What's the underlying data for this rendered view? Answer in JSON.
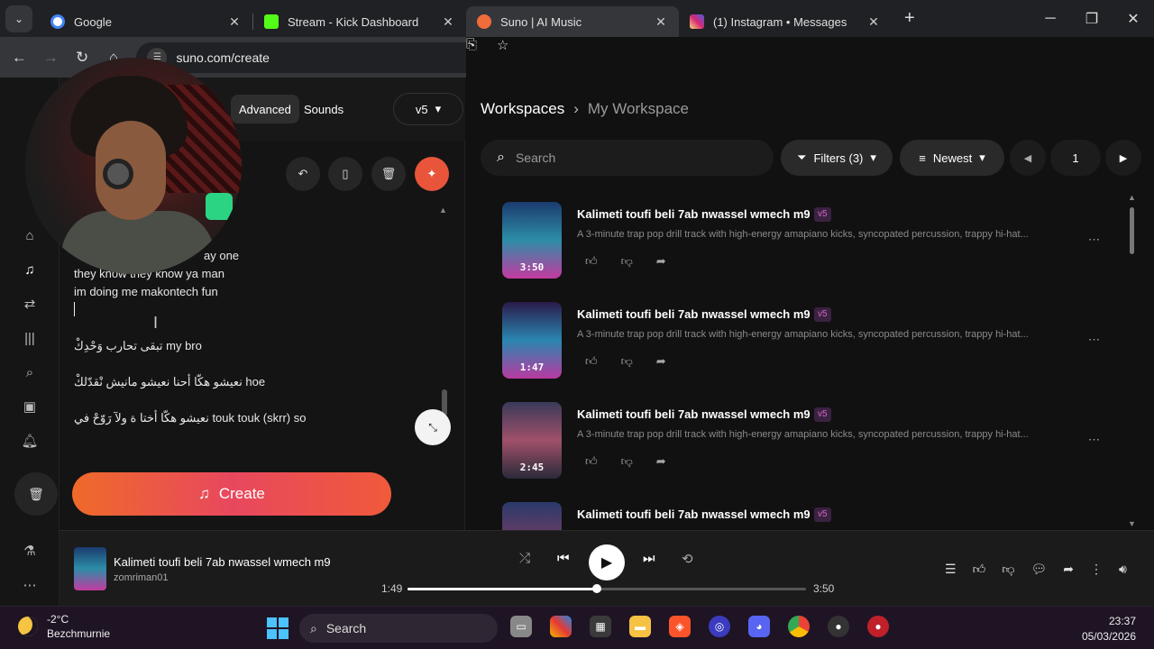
{
  "browser": {
    "tabs": [
      {
        "title": "Google",
        "favicon": "google-favicon",
        "color": "#4285f4"
      },
      {
        "title": "Stream - Kick Dashboard",
        "favicon": "kick-favicon",
        "color": "#53fc18"
      },
      {
        "title": "Suno | AI Music",
        "favicon": "suno-favicon",
        "color": "#f06c3a"
      },
      {
        "title": "(1) Instagram • Messages",
        "favicon": "instagram-favicon",
        "color": "#e1306c"
      }
    ],
    "url": "suno.com/create"
  },
  "create_panel": {
    "modes": [
      "Advanced",
      "Sounds"
    ],
    "version": "v5",
    "lyrics": [
      "they know they know ya man",
      "im doing me makontech fun",
      "",
      "تبقى  تحارب وَحْدِكْ my bro",
      "نعيشو هكّا أحنا  نعيشو مانيش نْقدّلكْ hoe",
      "نعيشو هكّا أختا ة  ولآ رَوّحْ في  touk touk (skrr) so"
    ],
    "partial_line": "ay one",
    "create_label": "Create"
  },
  "workspace": {
    "crumb_root": "Workspaces",
    "crumb_current": "My Workspace",
    "search_placeholder": "Search",
    "filters_label": "Filters (3)",
    "sort_label": "Newest",
    "page": "1",
    "songs": [
      {
        "title": "Kalimeti toufi beli 7ab nwassel wmech m9",
        "badge": "v5",
        "desc": "A 3-minute trap pop drill track with high-energy amapiano kicks, syncopated percussion, trappy hi-hat...",
        "duration": "3:50"
      },
      {
        "title": "Kalimeti toufi beli 7ab nwassel wmech m9",
        "badge": "v5",
        "desc": "A 3-minute trap pop drill track with high-energy amapiano kicks, syncopated percussion, trappy hi-hat...",
        "duration": "1:47"
      },
      {
        "title": "Kalimeti toufi beli 7ab nwassel wmech m9",
        "badge": "v5",
        "desc": "A 3-minute trap pop drill track with high-energy amapiano kicks, syncopated percussion, trappy hi-hat...",
        "duration": "2:45"
      },
      {
        "title": "Kalimeti toufi beli 7ab nwassel wmech m9",
        "badge": "v5",
        "desc": "",
        "duration": ""
      }
    ]
  },
  "player": {
    "title": "Kalimeti toufi beli 7ab nwassel wmech m9",
    "artist": "zomriman01",
    "elapsed": "1:49",
    "total": "3:50",
    "progress": 0.474
  },
  "taskbar": {
    "temp": "-2°C",
    "location": "Bezchmurnie",
    "search": "Search",
    "time": "23:37",
    "date": "05/03/2026"
  }
}
